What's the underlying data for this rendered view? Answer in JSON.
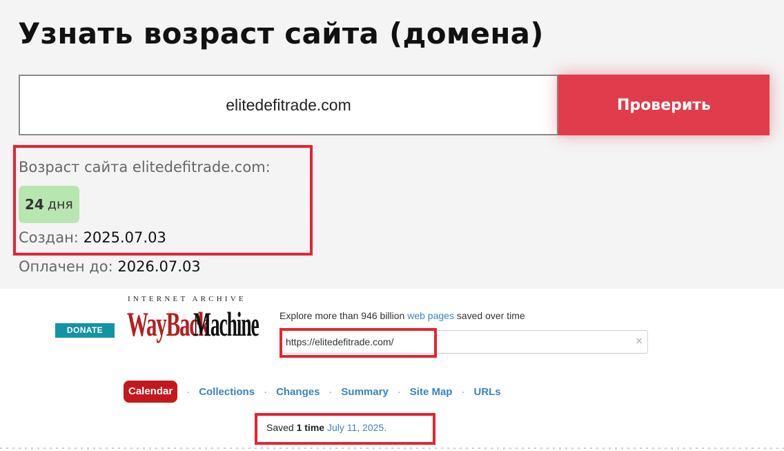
{
  "header": {
    "title": "Узнать возраст сайта (домена)"
  },
  "search": {
    "domain_value": "elitedefitrade.com",
    "check_label": "Проверить"
  },
  "result": {
    "age_label": "Возраст сайта elitedefitrade.com:",
    "age_number": "24",
    "age_unit": "дня",
    "created_label": "Создан:",
    "created_value": "2025.07.03",
    "paid_label": "Оплачен до:",
    "paid_value": "2026.07.03"
  },
  "wayback": {
    "donate_label": "DONATE",
    "ia_label": "INTERNET ARCHIVE",
    "logo_wayback": "WayBack",
    "logo_machine": "Machine",
    "explore_prefix": "Explore more than 946 billion",
    "explore_link": "web pages",
    "explore_suffix": "saved over time",
    "url_value": "https://elitedefitrade.com/",
    "clear_glyph": "×",
    "nav": {
      "calendar": "Calendar",
      "collections": "Collections",
      "changes": "Changes",
      "summary": "Summary",
      "site_map": "Site Map",
      "urls": "URLs",
      "separator": "·"
    },
    "saved_prefix": "Saved",
    "saved_count": "1 time",
    "saved_date": "July 11, 2025."
  },
  "colors": {
    "accent_red": "#e03c4c",
    "highlight_red": "#e8232f",
    "badge_green": "#b8e6b0",
    "link_blue": "#3b83c5",
    "wayback_red": "#c3181e",
    "donate_teal": "#1493a5"
  },
  "icons": {
    "clear": "close-icon"
  }
}
